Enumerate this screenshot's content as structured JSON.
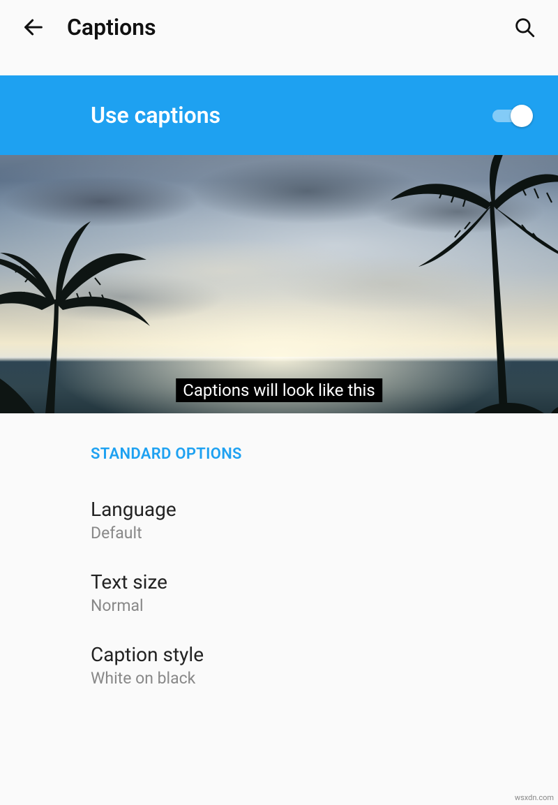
{
  "header": {
    "title": "Captions"
  },
  "toggle": {
    "label": "Use captions",
    "state": "on"
  },
  "preview": {
    "caption_text": "Captions will look like this"
  },
  "section": {
    "header": "STANDARD OPTIONS"
  },
  "options": [
    {
      "title": "Language",
      "value": "Default"
    },
    {
      "title": "Text size",
      "value": "Normal"
    },
    {
      "title": "Caption style",
      "value": "White on black"
    }
  ],
  "watermark": "wsxdn.com"
}
